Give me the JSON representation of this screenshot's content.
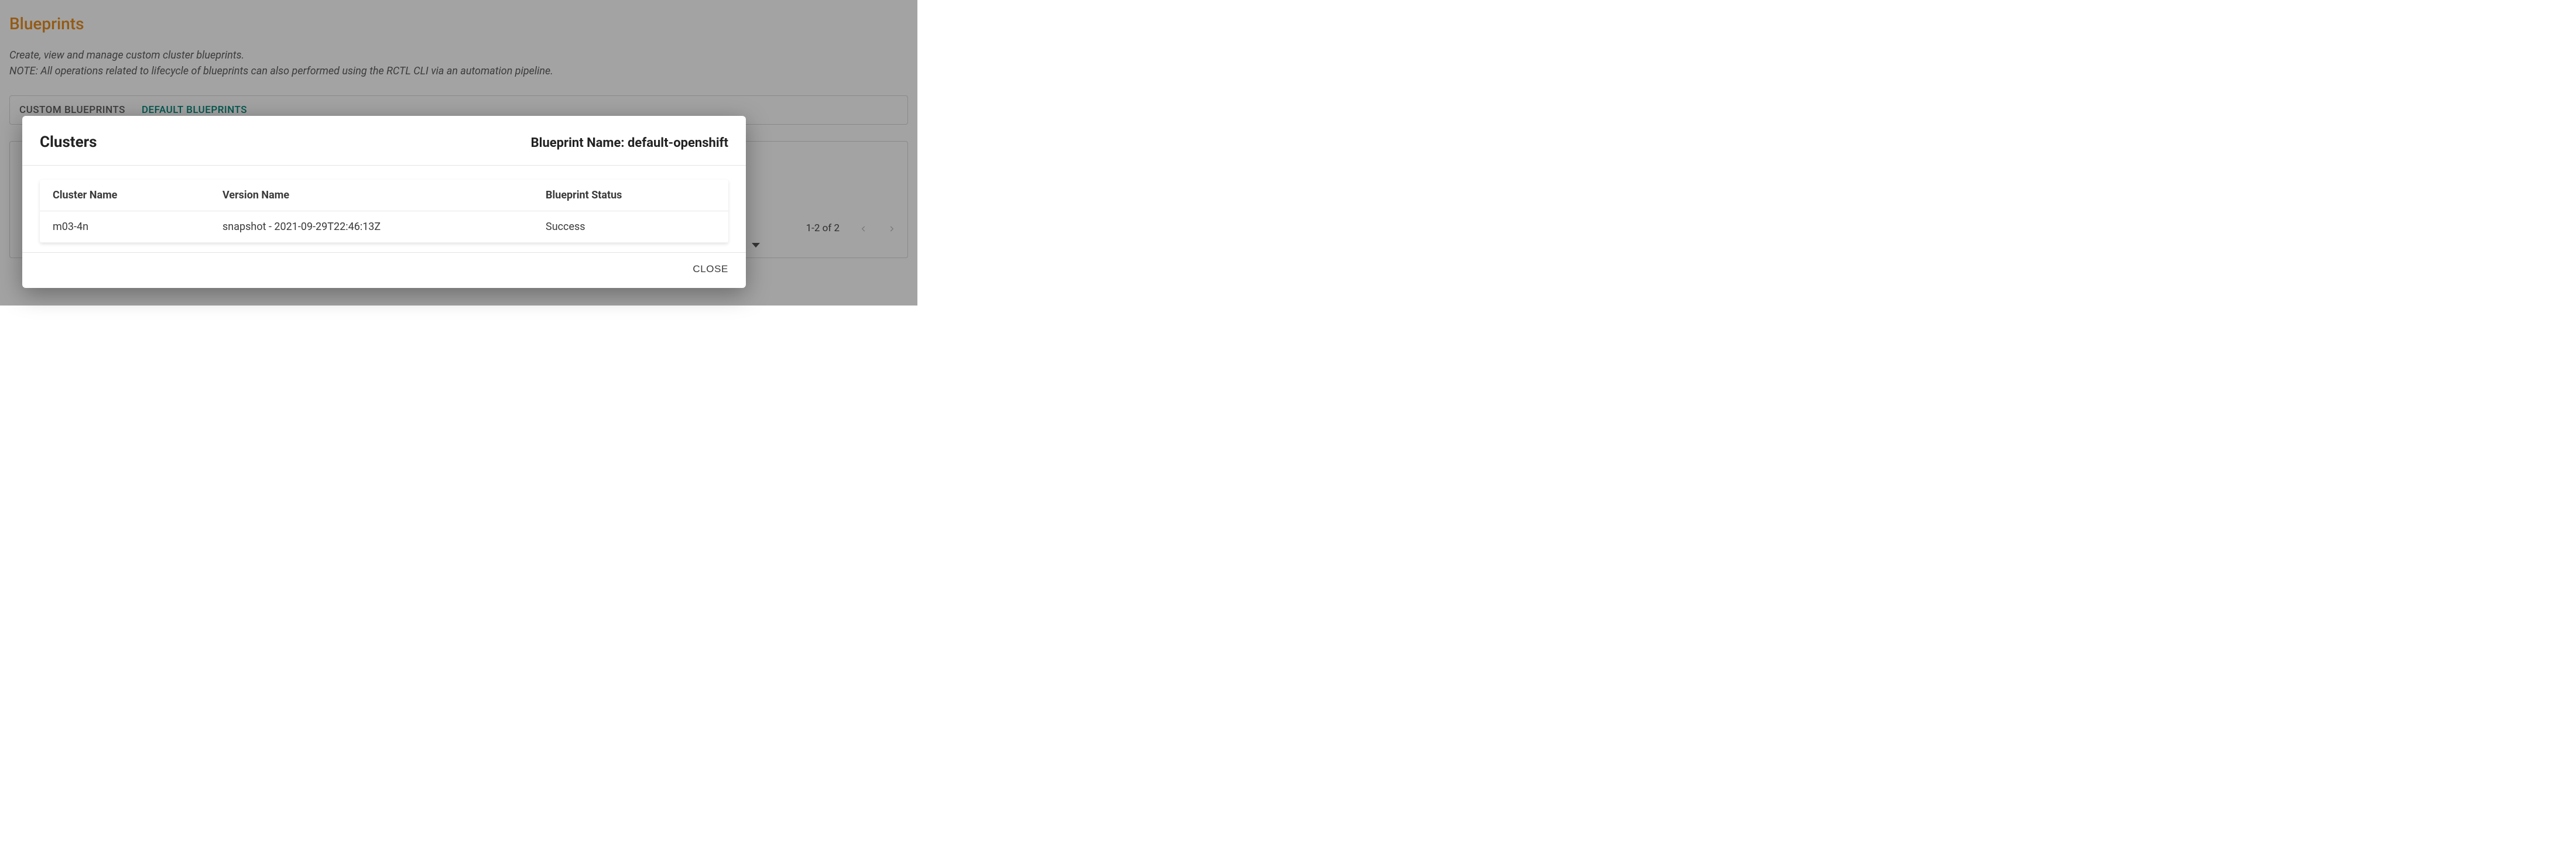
{
  "page": {
    "title": "Blueprints",
    "desc_line1": "Create, view and manage custom cluster blueprints.",
    "desc_line2": "NOTE: All operations related to lifecycle of blueprints can also performed using the RCTL CLI via an automation pipeline."
  },
  "tabs": {
    "custom": "CUSTOM BLUEPRINTS",
    "default": "DEFAULT BLUEPRINTS"
  },
  "pagination": {
    "range": "1-2 of 2"
  },
  "dialog": {
    "title": "Clusters",
    "bp_label": "Blueprint Name: ",
    "bp_value": "default-openshift",
    "columns": {
      "cluster": "Cluster Name",
      "version": "Version Name",
      "status": "Blueprint Status"
    },
    "rows": [
      {
        "cluster": "m03-4n",
        "version": "snapshot - 2021-09-29T22:46:13Z",
        "status": "Success"
      }
    ],
    "close": "CLOSE"
  }
}
